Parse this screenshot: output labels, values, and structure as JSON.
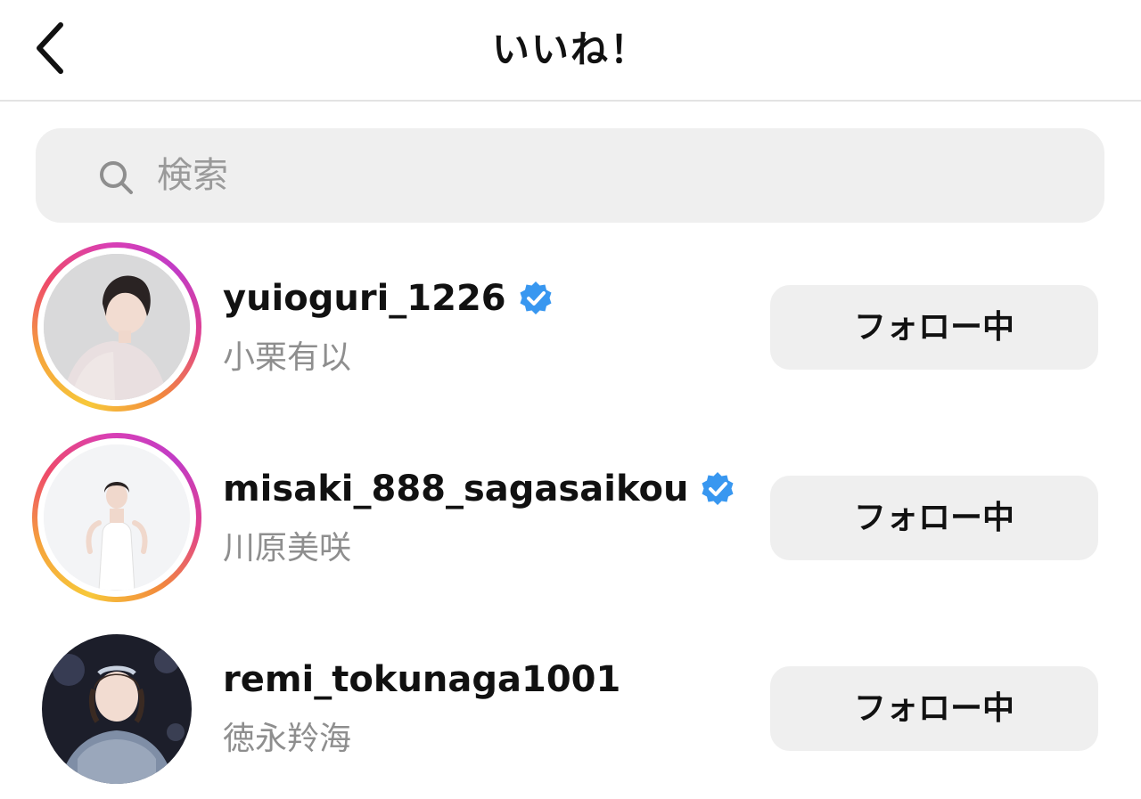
{
  "header": {
    "title": "いいね！",
    "back_icon": "chevron-left-icon"
  },
  "search": {
    "placeholder": "検索",
    "value": "",
    "icon": "search-icon"
  },
  "users": [
    {
      "username": "yuioguri_1226",
      "full_name": "小栗有以",
      "verified": true,
      "story_ring": true,
      "follow_label": "フォロー中"
    },
    {
      "username": "misaki_888_sagasaikou",
      "full_name": "川原美咲",
      "verified": true,
      "story_ring": true,
      "follow_label": "フォロー中"
    },
    {
      "username": "remi_tokunaga1001",
      "full_name": "徳永羚海",
      "verified": false,
      "story_ring": false,
      "follow_label": "フォロー中"
    }
  ],
  "colors": {
    "verified_badge": "#3897f0",
    "secondary_text": "#8e8e8e",
    "button_bg": "#efefef",
    "search_bg": "#efefef"
  }
}
